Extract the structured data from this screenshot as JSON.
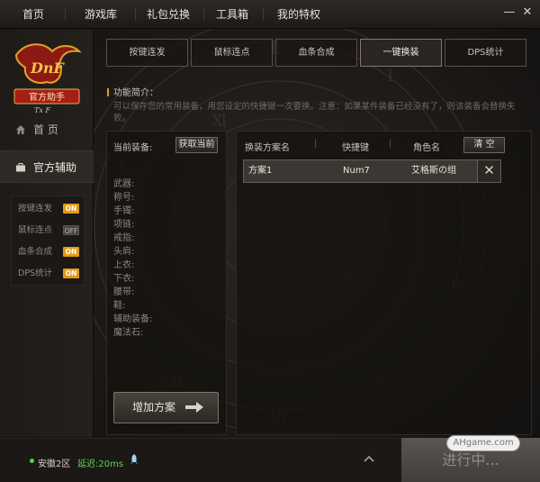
{
  "topnav": {
    "items": [
      "首页",
      "游戏库",
      "礼包兑换",
      "工具箱",
      "我的特权"
    ],
    "window_controls": {
      "minimize": "—",
      "close": "✕"
    }
  },
  "sidebar": {
    "logo_text": "官方助手",
    "nav": [
      {
        "label": "首 页",
        "icon": "home-icon"
      },
      {
        "label": "官方辅助",
        "icon": "briefcase-icon",
        "active": true
      }
    ],
    "features": [
      {
        "label": "按键连发",
        "toggle": "ON"
      },
      {
        "label": "鼠标连点",
        "toggle": "OFF"
      },
      {
        "label": "血条合成",
        "toggle": "ON"
      },
      {
        "label": "DPS统计",
        "toggle": "ON"
      }
    ]
  },
  "tabs": [
    {
      "label": "按键连发"
    },
    {
      "label": "鼠标连点"
    },
    {
      "label": "血条合成"
    },
    {
      "label": "一键换装",
      "active": true
    },
    {
      "label": "DPS统计"
    }
  ],
  "intro": {
    "title": "功能简介：",
    "desc": "可以保存您的常用装备，用您设定的快捷键一次要换。注意：如果某件装备已经没有了，则该装备会替换失败。"
  },
  "equip": {
    "header": "当前装备:",
    "fetch_button": "获取当前",
    "slots": [
      "武器:",
      "称号:",
      "手镯:",
      "项链:",
      "戒指:",
      "头肩:",
      "上衣:",
      "下衣:",
      "腰带:",
      "鞋:",
      "辅助装备:",
      "魔法石:"
    ],
    "add_button": "增加方案"
  },
  "plans": {
    "columns": [
      "换装方案名",
      "快捷键",
      "角色名"
    ],
    "clear_button": "清 空",
    "rows": [
      {
        "name": "方案1",
        "hotkey": "Num7",
        "role": "艾格斯の组"
      }
    ]
  },
  "footer": {
    "server": "安徽2区",
    "latency": "延迟:20ms",
    "launch_button": "进行中...",
    "watermark": "AHgame.com"
  },
  "colors": {
    "accent": "#e39a14",
    "online": "#4fd34a"
  }
}
